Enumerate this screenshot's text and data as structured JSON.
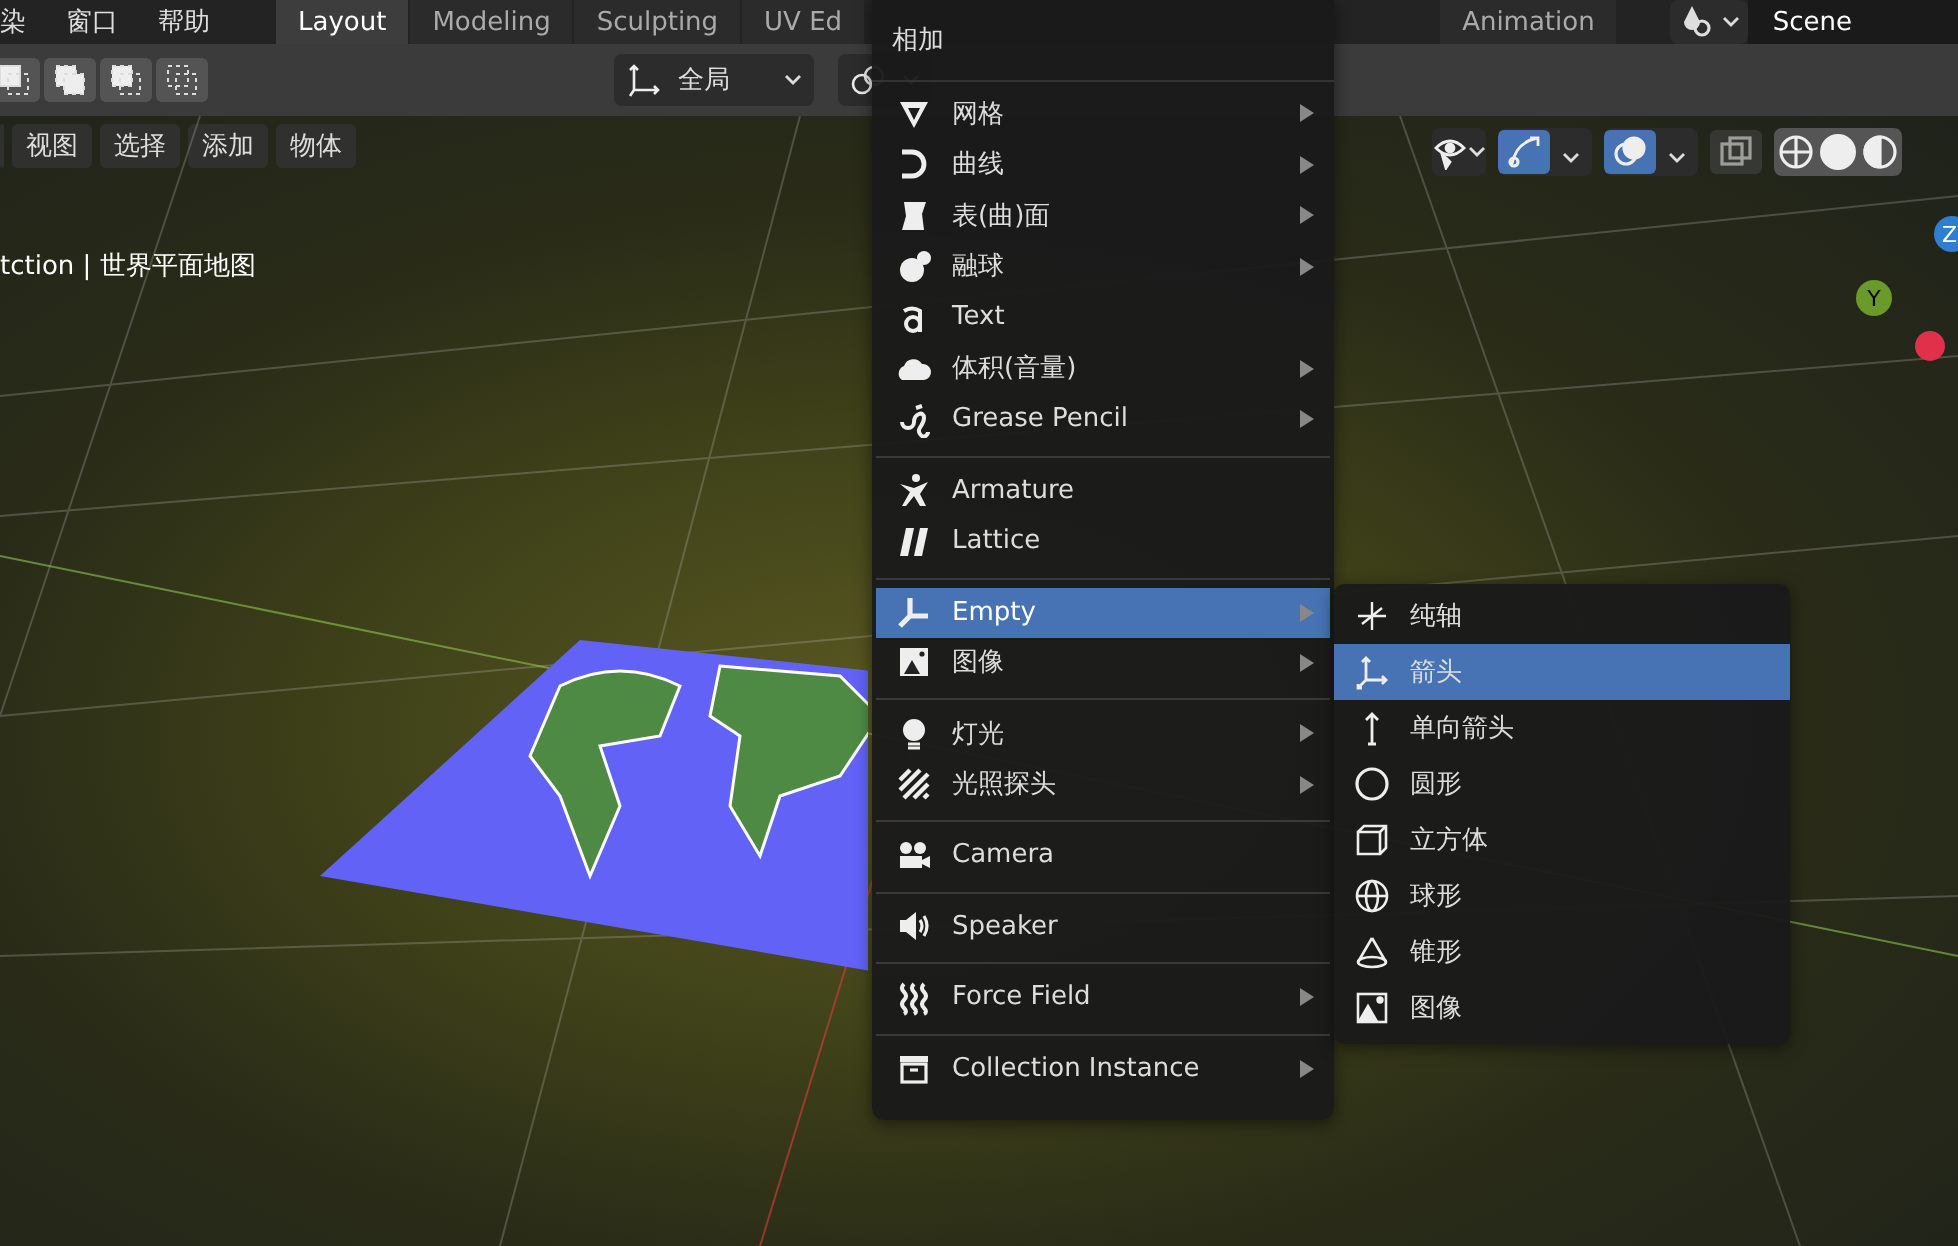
{
  "menubar": {
    "items": [
      "染",
      "窗口",
      "帮助"
    ]
  },
  "workspace_tabs": [
    {
      "label": "Layout",
      "selected": true
    },
    {
      "label": "Modeling",
      "selected": false
    },
    {
      "label": "Sculpting",
      "selected": false
    },
    {
      "label": "UV Ed",
      "selected": false
    },
    {
      "label": "Animation",
      "selected": false
    }
  ],
  "scene": {
    "name": "Scene"
  },
  "toolbar": {
    "orientation": "全局"
  },
  "viewport": {
    "menus": [
      "视图",
      "选择",
      "添加",
      "物体"
    ],
    "overlay_text": "tction | 世界平面地图",
    "gizmo_axes": [
      "Z",
      "Y"
    ]
  },
  "add_menu": {
    "title": "相加",
    "groups": [
      [
        {
          "label": "网格",
          "submenu": true,
          "selected": false
        },
        {
          "label": "曲线",
          "submenu": true,
          "selected": false
        },
        {
          "label": "表(曲)面",
          "submenu": true,
          "selected": false
        },
        {
          "label": "融球",
          "submenu": true,
          "selected": false
        },
        {
          "label": "Text",
          "submenu": false,
          "selected": false
        },
        {
          "label": "体积(音量)",
          "submenu": true,
          "selected": false
        },
        {
          "label": "Grease Pencil",
          "submenu": true,
          "selected": false
        }
      ],
      [
        {
          "label": "Armature",
          "submenu": false,
          "selected": false
        },
        {
          "label": "Lattice",
          "submenu": false,
          "selected": false
        }
      ],
      [
        {
          "label": "Empty",
          "submenu": true,
          "selected": true
        },
        {
          "label": "图像",
          "submenu": true,
          "selected": false
        }
      ],
      [
        {
          "label": "灯光",
          "submenu": true,
          "selected": false
        },
        {
          "label": "光照探头",
          "submenu": true,
          "selected": false
        }
      ],
      [
        {
          "label": "Camera",
          "submenu": false,
          "selected": false
        }
      ],
      [
        {
          "label": "Speaker",
          "submenu": false,
          "selected": false
        }
      ],
      [
        {
          "label": "Force Field",
          "submenu": true,
          "selected": false
        }
      ],
      [
        {
          "label": "Collection Instance",
          "submenu": true,
          "selected": false
        }
      ]
    ]
  },
  "empty_submenu": {
    "items": [
      {
        "label": "纯轴",
        "selected": false
      },
      {
        "label": "箭头",
        "selected": true
      },
      {
        "label": "单向箭头",
        "selected": false
      },
      {
        "label": "圆形",
        "selected": false
      },
      {
        "label": "立方体",
        "selected": false
      },
      {
        "label": "球形",
        "selected": false
      },
      {
        "label": "锥形",
        "selected": false
      },
      {
        "label": "图像",
        "selected": false
      }
    ]
  }
}
